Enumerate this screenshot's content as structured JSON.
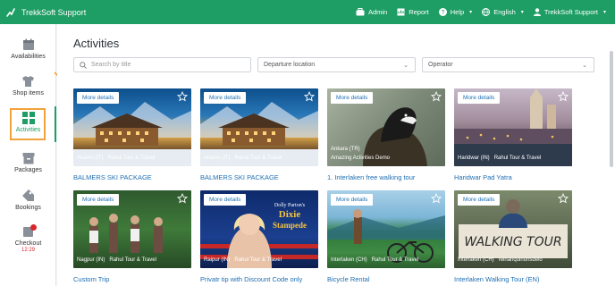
{
  "header": {
    "app_name": "TrekkSoft Support",
    "nav": {
      "admin": "Admin",
      "report": "Report",
      "help": "Help",
      "language": "English",
      "user": "TrekkSoft Support"
    }
  },
  "sidebar": {
    "items": [
      {
        "label": "Availabilities",
        "icon": "calendar-icon"
      },
      {
        "label": "Shop items",
        "icon": "tshirt-icon"
      },
      {
        "label": "Activities",
        "icon": "grid-icon"
      },
      {
        "label": "Packages",
        "icon": "package-icon"
      },
      {
        "label": "Bookings",
        "icon": "tag-icon"
      },
      {
        "label": "Checkout",
        "icon": "cart-icon"
      }
    ],
    "checkout_timer": "12:29",
    "active_item": "Activities"
  },
  "main": {
    "title": "Activities",
    "search_placeholder": "Search by title",
    "location_select": "Departure location",
    "operator_select": "Operator"
  },
  "more_details_label": "More details",
  "cards": [
    {
      "title": "BALMERS SKI PACKAGE",
      "location": "Akamo (IT)",
      "operator": "Rahul Tour & Travel"
    },
    {
      "title": "BALMERS SKI PACKAGE",
      "location": "Akamo (IT)",
      "operator": "Rahul Tour & Travel"
    },
    {
      "title": "1. Interlaken free walking tour",
      "location": "Ankara (TR)",
      "operator": "Amazing Activities Demo"
    },
    {
      "title": "Haridwar Pad Yatra",
      "location": "Haridwar (IN)",
      "operator": "Rahul Tour & Travel"
    },
    {
      "title": "Custom Trip",
      "location": "Nagpur (IN)",
      "operator": "Rahul Tour & Travel"
    },
    {
      "title": "Privatr tip with Discount Code only",
      "location": "Raipur (IN)",
      "operator": "Rahul Tour & Travel"
    },
    {
      "title": "Bicycle Rental",
      "location": "Interlaken (CH)",
      "operator": "Rahul Tour & Travel"
    },
    {
      "title": "Interlaken Walking Tour (EN)",
      "location": "Interlaken (CH)",
      "operator": "reinanquinonsdelo"
    }
  ],
  "colors": {
    "brand_green": "#1e9e64",
    "link_blue": "#1e6fb3",
    "highlight_orange": "#f2a23a",
    "timer_red": "#d9262c"
  }
}
